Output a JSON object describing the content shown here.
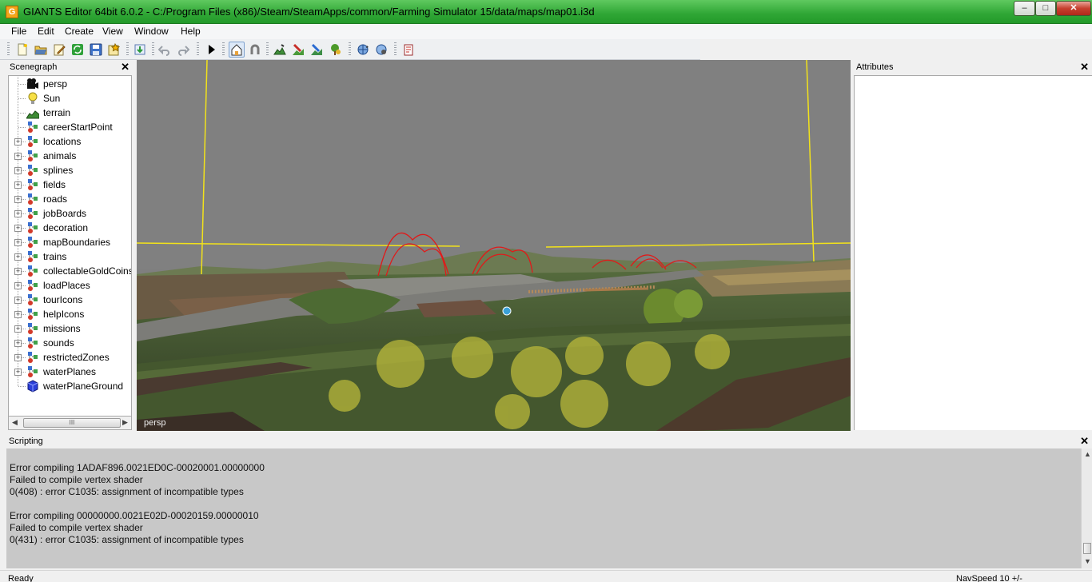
{
  "window": {
    "title": "GIANTS Editor 64bit 6.0.2 - C:/Program Files (x86)/Steam/SteamApps/common/Farming Simulator 15/data/maps/map01.i3d",
    "minimize": "–",
    "maximize": "□",
    "close": "✕"
  },
  "menu": [
    "File",
    "Edit",
    "Create",
    "View",
    "Window",
    "Help"
  ],
  "toolbar": {
    "icons": [
      "new-file-icon",
      "open-folder-icon",
      "edit-note-icon",
      "refresh-icon",
      "save-icon",
      "save-as-icon",
      "import-icon",
      "undo-icon",
      "redo-icon",
      "play-icon",
      "home-camera-icon",
      "magnet-icon",
      "terrain-sculpt-icon",
      "terrain-paint-icon",
      "foliage-paint-icon",
      "tree-paint-icon",
      "rotate-globe-icon",
      "settings-globe-icon",
      "script-icon"
    ]
  },
  "scenegraph": {
    "title": "Scenegraph",
    "close": "✕",
    "scroll_thumb": "III",
    "items": [
      {
        "label": "persp",
        "icon": "camera-icon",
        "expandable": false
      },
      {
        "label": "Sun",
        "icon": "light-bulb-icon",
        "expandable": false
      },
      {
        "label": "terrain",
        "icon": "terrain-icon",
        "expandable": false
      },
      {
        "label": "careerStartPoint",
        "icon": "transform-group-icon",
        "expandable": false
      },
      {
        "label": "locations",
        "icon": "transform-group-icon",
        "expandable": true
      },
      {
        "label": "animals",
        "icon": "transform-group-icon",
        "expandable": true
      },
      {
        "label": "splines",
        "icon": "transform-group-icon",
        "expandable": true
      },
      {
        "label": "fields",
        "icon": "transform-group-icon",
        "expandable": true
      },
      {
        "label": "roads",
        "icon": "transform-group-icon",
        "expandable": true
      },
      {
        "label": "jobBoards",
        "icon": "transform-group-icon",
        "expandable": true
      },
      {
        "label": "decoration",
        "icon": "transform-group-icon",
        "expandable": true
      },
      {
        "label": "mapBoundaries",
        "icon": "transform-group-icon",
        "expandable": true
      },
      {
        "label": "trains",
        "icon": "transform-group-icon",
        "expandable": true
      },
      {
        "label": "collectableGoldCoins",
        "icon": "transform-group-icon",
        "expandable": true
      },
      {
        "label": "loadPlaces",
        "icon": "transform-group-icon",
        "expandable": true
      },
      {
        "label": "tourIcons",
        "icon": "transform-group-icon",
        "expandable": true
      },
      {
        "label": "helpIcons",
        "icon": "transform-group-icon",
        "expandable": true
      },
      {
        "label": "missions",
        "icon": "transform-group-icon",
        "expandable": true
      },
      {
        "label": "sounds",
        "icon": "transform-group-icon",
        "expandable": true
      },
      {
        "label": "restrictedZones",
        "icon": "transform-group-icon",
        "expandable": true
      },
      {
        "label": "waterPlanes",
        "icon": "transform-group-icon",
        "expandable": true
      },
      {
        "label": "waterPlaneGround",
        "icon": "shape-cube-icon",
        "expandable": false
      }
    ]
  },
  "viewport": {
    "camera_label": "persp"
  },
  "attributes": {
    "title": "Attributes",
    "close": "✕"
  },
  "scripting": {
    "title": "Scripting",
    "close": "✕",
    "lines": [
      "Error compiling 1ADAF896.0021ED0C-00020001.00000000",
      "Failed to compile vertex shader",
      "0(408) : error C1035: assignment of incompatible types",
      "",
      "Error compiling 00000000.0021E02D-00020159.00000010",
      "Failed to compile vertex shader",
      "0(431) : error C1035: assignment of incompatible types"
    ]
  },
  "status": {
    "left": "Ready",
    "right": "NavSpeed 10 +/-"
  }
}
